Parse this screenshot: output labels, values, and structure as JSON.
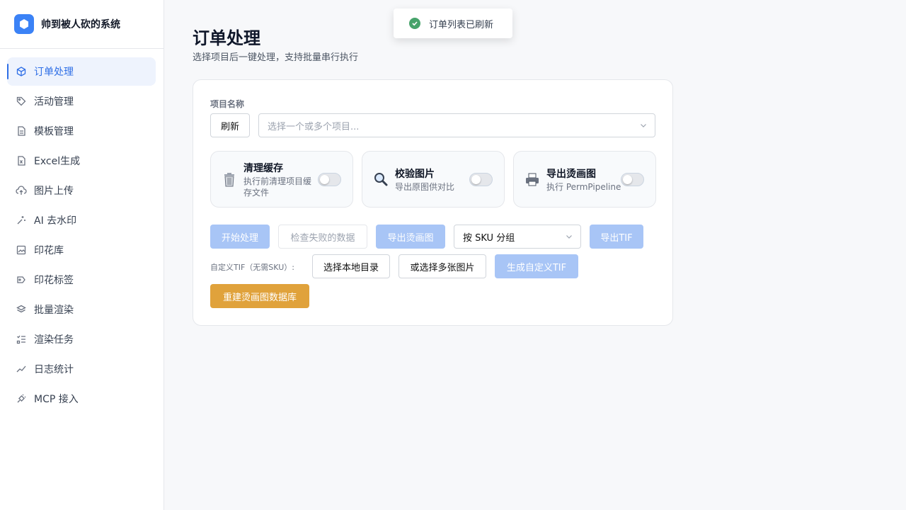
{
  "app": {
    "title": "帅到被人砍的系统",
    "accent": "#3b82f6"
  },
  "sidebar": {
    "items": [
      {
        "label": "订单处理",
        "icon": "cube-icon",
        "active": true
      },
      {
        "label": "活动管理",
        "icon": "tag-icon"
      },
      {
        "label": "模板管理",
        "icon": "file-text-icon"
      },
      {
        "label": "Excel生成",
        "icon": "file-spreadsheet-icon"
      },
      {
        "label": "图片上传",
        "icon": "cloud-upload-icon"
      },
      {
        "label": "AI 去水印",
        "icon": "sparkle-wand-icon"
      },
      {
        "label": "印花库",
        "icon": "image-gallery-icon"
      },
      {
        "label": "印花标签",
        "icon": "label-tag-icon"
      },
      {
        "label": "批量渲染",
        "icon": "layers-icon"
      },
      {
        "label": "渲染任务",
        "icon": "task-list-icon"
      },
      {
        "label": "日志统计",
        "icon": "trend-line-icon"
      },
      {
        "label": "MCP 接入",
        "icon": "plug-icon"
      }
    ]
  },
  "page": {
    "title": "订单处理",
    "subtitle": "选择项目后一键处理，支持批量串行执行"
  },
  "form": {
    "project_label": "项目名称",
    "refresh_label": "刷新",
    "project_placeholder": "选择一个或多个项目..."
  },
  "options": [
    {
      "title": "清理缓存",
      "desc": "执行前清理项目缓存文件",
      "icon": "trash-icon",
      "enabled": false
    },
    {
      "title": "校验图片",
      "desc": "导出原图供对比",
      "icon": "magnifier-icon",
      "enabled": false
    },
    {
      "title": "导出烫画图",
      "desc": "执行 PermPipeline",
      "icon": "printer-icon",
      "enabled": false
    }
  ],
  "actions": {
    "start": "开始处理",
    "check_failed": "检查失败的数据",
    "export_transfer": "导出烫画图",
    "group_by": "按 SKU 分组",
    "export_tif": "导出TIF",
    "custom_tif_label": "自定义TIF（无需SKU）:",
    "choose_dir": "选择本地目录",
    "choose_images": "或选择多张图片",
    "generate_tif": "生成自定义TIF",
    "rebuild_db": "重建烫画图数据库"
  },
  "toast": {
    "message": "订单列表已刷新",
    "status_color": "#47a36b"
  }
}
